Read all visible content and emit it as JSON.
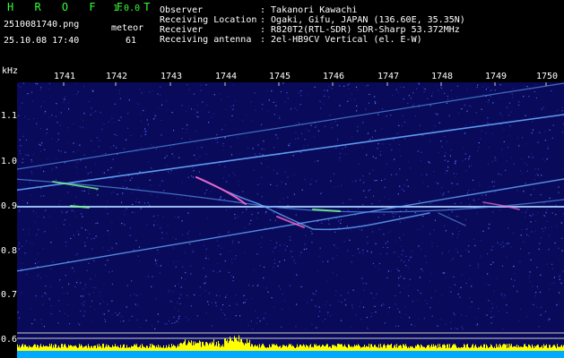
{
  "app": {
    "name": "H R O F F T",
    "version": "1.0.0"
  },
  "file": {
    "name": "2510081740.png",
    "datetime": "25.10.08 17:40"
  },
  "meteor": {
    "label": "meteor",
    "count": "61"
  },
  "info": [
    {
      "key": "Observer",
      "value": ": Takanori Kawachi"
    },
    {
      "key": "Receiving Location",
      "value": ": Ogaki, Gifu, JAPAN (136.60E, 35.35N)"
    },
    {
      "key": "Receiver",
      "value": ": R820T2(RTL-SDR) SDR-Sharp 53.372MHz"
    },
    {
      "key": "Receiving antenna",
      "value": ": 2el-HB9CV Vertical (el. E-W)"
    }
  ],
  "axis": {
    "unit": "kHz",
    "y_ticks": [
      "1.1",
      "1.0",
      "0.9",
      "0.8",
      "0.7",
      "0.6"
    ],
    "x_ticks": [
      "1741",
      "1742",
      "1743",
      "1744",
      "1745",
      "1746",
      "1747",
      "1748",
      "1749",
      "1750"
    ]
  },
  "colors": {
    "background": "#000000",
    "spectrogram_bg": "#0a0a5a",
    "grid": "#cccccc",
    "trace": "#66aaff",
    "carrier": "#aaccff",
    "meteor_hot": "#ff66cc",
    "level_bar": "#ffff00",
    "level_base": "#00aaff"
  }
}
